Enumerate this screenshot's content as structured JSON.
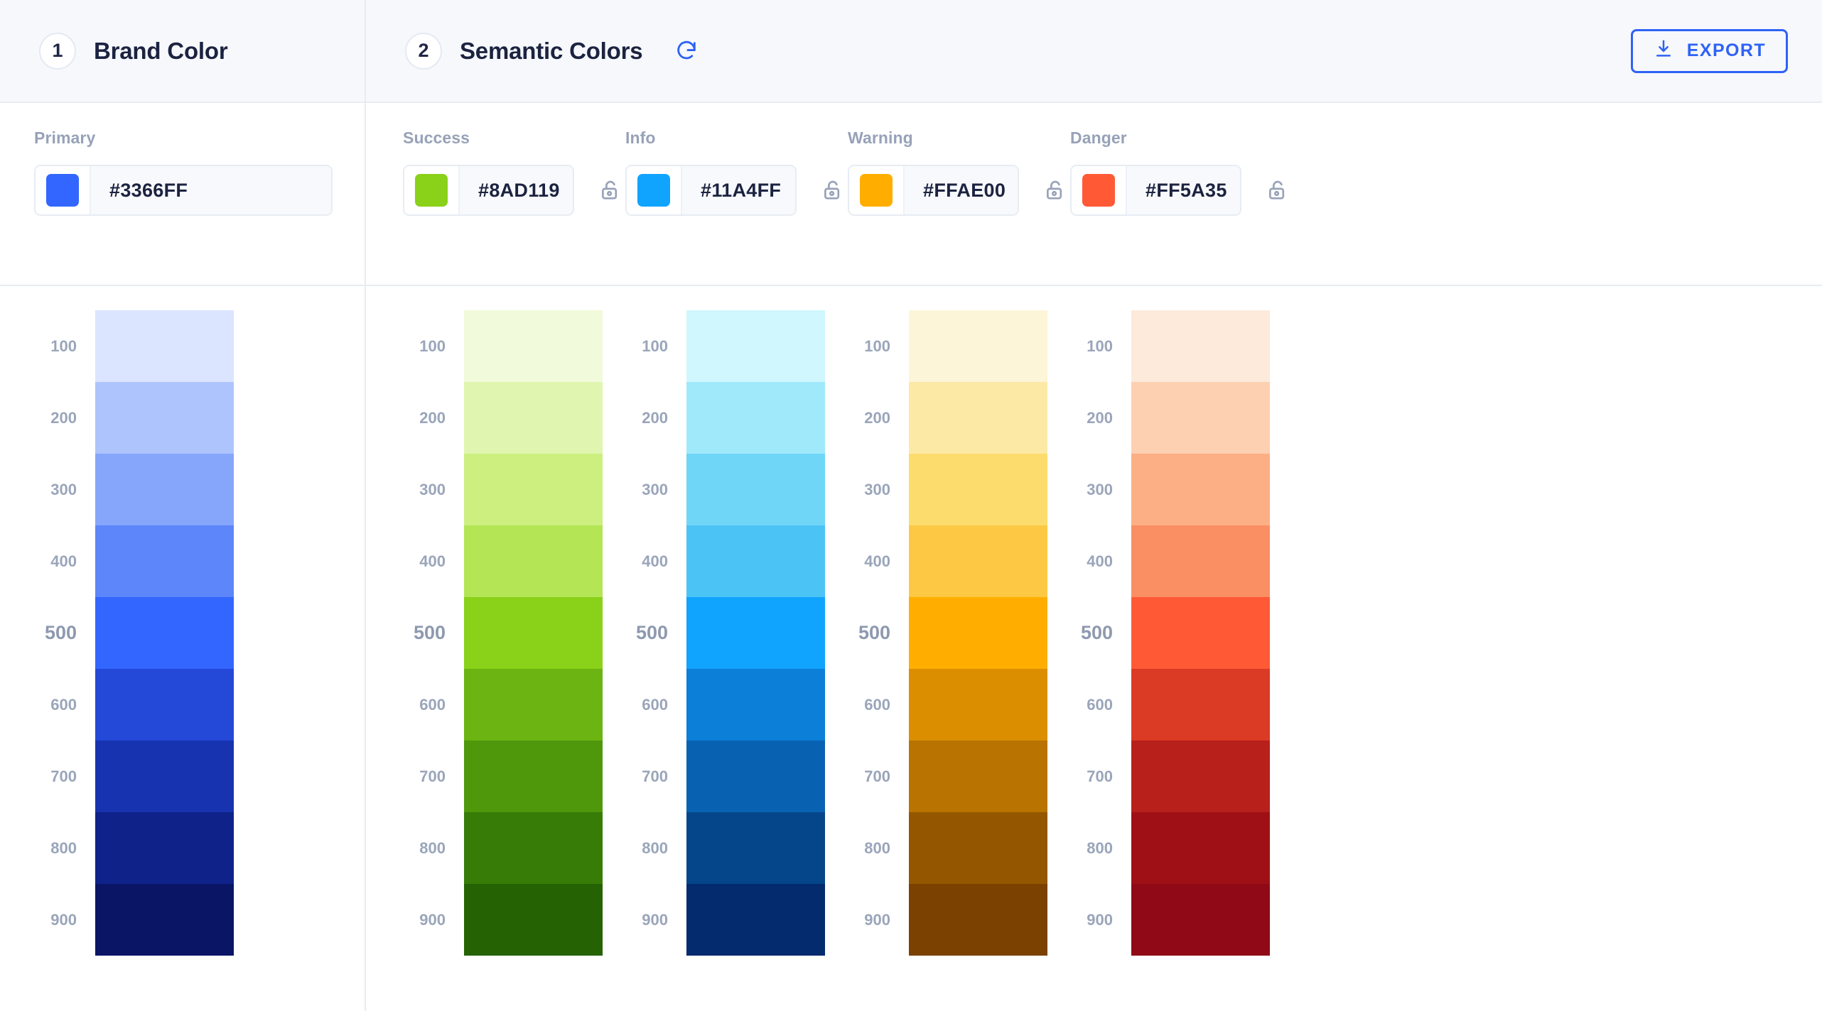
{
  "header": {
    "brand_step": {
      "number": "1",
      "title": "Brand Color"
    },
    "semantic_step": {
      "number": "2",
      "title": "Semantic Colors"
    },
    "refresh_icon": "refresh-icon",
    "export": {
      "label": "EXPORT",
      "icon": "download-icon",
      "accent": "#2F62F5"
    }
  },
  "brand": {
    "field": {
      "label": "Primary",
      "value": "#3366FF",
      "swatch": "#3366FF",
      "placeholder": "#000000"
    }
  },
  "semantic": {
    "fields": [
      {
        "label": "Success",
        "value": "#8AD119",
        "swatch": "#8AD119",
        "placeholder": "#000000",
        "lock_icon": "unlock-icon",
        "locked": false
      },
      {
        "label": "Info",
        "value": "#11A4FF",
        "swatch": "#11A4FF",
        "placeholder": "#000000",
        "lock_icon": "unlock-icon",
        "locked": false
      },
      {
        "label": "Warning",
        "value": "#FFAE00",
        "swatch": "#FFAE00",
        "placeholder": "#000000",
        "lock_icon": "unlock-icon",
        "locked": false
      },
      {
        "label": "Danger",
        "value": "#FF5A35",
        "swatch": "#FF5A35",
        "placeholder": "#000000",
        "lock_icon": "unlock-icon",
        "locked": false
      }
    ]
  },
  "shade_labels": [
    "100",
    "200",
    "300",
    "400",
    "500",
    "600",
    "700",
    "800",
    "900"
  ],
  "base_shade": "500",
  "chart_data": {
    "type": "table",
    "title": "Color palette shade ramps",
    "categories": [
      "100",
      "200",
      "300",
      "400",
      "500",
      "600",
      "700",
      "800",
      "900"
    ],
    "series": [
      {
        "name": "Primary",
        "base": "#3366FF",
        "values": [
          "#DCE5FF",
          "#AEC4FD",
          "#85A6FB",
          "#5C86F9",
          "#3366FF",
          "#2449D8",
          "#1733B0",
          "#0E2289",
          "#0A1566"
        ]
      },
      {
        "name": "Success",
        "base": "#8AD119",
        "values": [
          "#F1FADA",
          "#E0F6B0",
          "#CCEF80",
          "#B4E554",
          "#8AD119",
          "#6BB412",
          "#4F980C",
          "#377C07",
          "#256204"
        ]
      },
      {
        "name": "Info",
        "base": "#11A4FF",
        "values": [
          "#CFF7FD",
          "#A0E9FB",
          "#70D6F8",
          "#4CC3F5",
          "#11A4FF",
          "#0C7FD8",
          "#0862B1",
          "#05468A",
          "#032B6E"
        ]
      },
      {
        "name": "Warning",
        "base": "#FFAE00",
        "values": [
          "#FDF5D8",
          "#FCE9A6",
          "#FBDC6D",
          "#FDC945",
          "#FFAE00",
          "#DB8F00",
          "#B87300",
          "#945700",
          "#7A4100"
        ]
      },
      {
        "name": "Danger",
        "base": "#FF5A35",
        "values": [
          "#FDEADB",
          "#FDD0B2",
          "#FCAF85",
          "#FA8F64",
          "#FF5A35",
          "#DB3A25",
          "#B7201B",
          "#9E1015",
          "#8F0A16"
        ]
      }
    ]
  }
}
